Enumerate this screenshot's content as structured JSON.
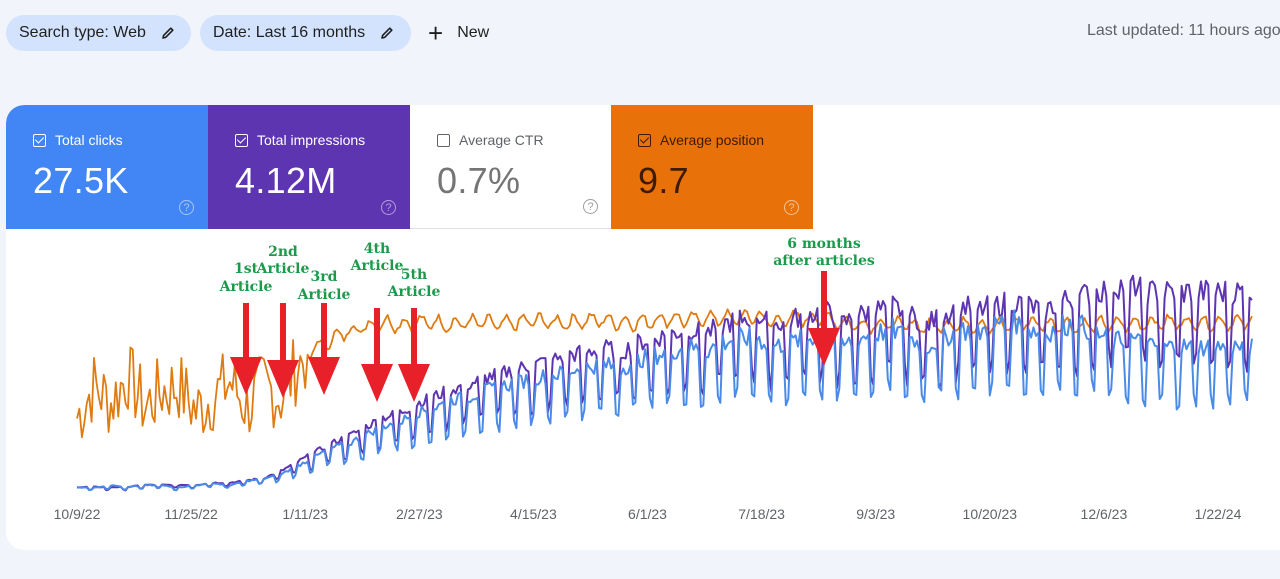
{
  "filters": {
    "chips": [
      {
        "label": "Search type: Web",
        "icon": "pencil-icon"
      },
      {
        "label": "Date: Last 16 months",
        "icon": "pencil-icon"
      }
    ],
    "new_label": "New",
    "new_icon": "plus-icon"
  },
  "last_updated": "Last updated: 11 hours ago",
  "metrics": [
    {
      "label": "Total clicks",
      "value": "27.5K",
      "checked": true,
      "color": "#4285f4"
    },
    {
      "label": "Total impressions",
      "value": "4.12M",
      "checked": true,
      "color": "#5e35b1"
    },
    {
      "label": "Average CTR",
      "value": "0.7%",
      "checked": false,
      "color": "#ffffff"
    },
    {
      "label": "Average position",
      "value": "9.7",
      "checked": true,
      "color": "#e8710a"
    }
  ],
  "help_glyph": "?",
  "chart_data": {
    "type": "line",
    "title": "",
    "xlabel": "",
    "ylabel": "",
    "x_ticks": [
      "10/9/22",
      "11/25/22",
      "1/11/23",
      "2/27/23",
      "4/15/23",
      "6/1/23",
      "7/18/23",
      "9/3/23",
      "10/20/23",
      "12/6/23",
      "1/22/24"
    ],
    "x_range": [
      "10/9/22",
      "2/5/24"
    ],
    "y_axis_labels_visible": false,
    "grid": false,
    "legend": "metric cards above chart",
    "series": [
      {
        "name": "Total clicks",
        "color": "#4a8be8",
        "description": "flat near zero until ~1/11/23, rises steadily with weekly oscillation to ~60-75% of scale by 9/3/23, then oscillates broadly 35-90% of scale",
        "weekly_values_relative": [
          0.02,
          0.02,
          0.03,
          0.02,
          0.03,
          0.03,
          0.02,
          0.03,
          0.04,
          0.03,
          0.05,
          0.06,
          0.08,
          0.12,
          0.16,
          0.2,
          0.22,
          0.26,
          0.3,
          0.32,
          0.36,
          0.38,
          0.42,
          0.43,
          0.46,
          0.48,
          0.5,
          0.52,
          0.53,
          0.55,
          0.57,
          0.58,
          0.56,
          0.6,
          0.62,
          0.64,
          0.66,
          0.64,
          0.68,
          0.7,
          0.7,
          0.66,
          0.68,
          0.7,
          0.72,
          0.66,
          0.7,
          0.72,
          0.74,
          0.7,
          0.66,
          0.7,
          0.74,
          0.72,
          0.76,
          0.78,
          0.74,
          0.72,
          0.76,
          0.76,
          0.72,
          0.68,
          0.7,
          0.66
        ]
      },
      {
        "name": "Total impressions",
        "color": "#5e35b1",
        "description": "tracks clicks closely, slightly higher peaks; ends near top of plot",
        "weekly_values_relative": [
          0.02,
          0.02,
          0.02,
          0.02,
          0.03,
          0.03,
          0.03,
          0.03,
          0.04,
          0.04,
          0.05,
          0.06,
          0.09,
          0.13,
          0.17,
          0.21,
          0.24,
          0.28,
          0.32,
          0.34,
          0.38,
          0.41,
          0.44,
          0.46,
          0.49,
          0.51,
          0.53,
          0.55,
          0.57,
          0.59,
          0.6,
          0.62,
          0.6,
          0.64,
          0.66,
          0.68,
          0.7,
          0.68,
          0.72,
          0.74,
          0.76,
          0.72,
          0.74,
          0.76,
          0.78,
          0.72,
          0.76,
          0.78,
          0.8,
          0.76,
          0.72,
          0.76,
          0.8,
          0.78,
          0.8,
          0.82,
          0.8,
          0.78,
          0.82,
          0.84,
          0.86,
          0.88,
          0.9,
          0.86
        ]
      },
      {
        "name": "Average position",
        "color": "#e07b12",
        "description": "noisy & lower early (before articles), jumps up ~1/11/23–2/27/23, then steady near upper-middle with small oscillation",
        "weekly_values_relative": [
          0.35,
          0.5,
          0.42,
          0.55,
          0.4,
          0.48,
          0.5,
          0.38,
          0.45,
          0.52,
          0.4,
          0.5,
          0.45,
          0.6,
          0.68,
          0.72,
          0.76,
          0.78,
          0.8,
          0.79,
          0.8,
          0.8,
          0.79,
          0.8,
          0.8,
          0.79,
          0.8,
          0.81,
          0.8,
          0.8,
          0.81,
          0.81,
          0.8,
          0.8,
          0.81,
          0.82,
          0.81,
          0.82,
          0.82,
          0.82,
          0.83,
          0.8,
          0.82,
          0.82,
          0.82,
          0.8,
          0.79,
          0.79,
          0.79,
          0.79,
          0.78,
          0.79,
          0.79,
          0.79,
          0.78,
          0.79,
          0.8,
          0.79,
          0.79,
          0.78,
          0.79,
          0.79,
          0.79,
          0.8
        ]
      }
    ],
    "annotations": [
      {
        "text": [
          "1st",
          "Article"
        ],
        "date": "12/9/22"
      },
      {
        "text": [
          "2nd",
          "Article"
        ],
        "date": "12/26/22"
      },
      {
        "text": [
          "3rd",
          "Article"
        ],
        "date": "1/11/23"
      },
      {
        "text": [
          "4th",
          "Article"
        ],
        "date": "1/31/23"
      },
      {
        "text": [
          "5th",
          "Article"
        ],
        "date": "2/13/23"
      },
      {
        "text": [
          "6 months",
          "after articles"
        ],
        "date": "8/18/23"
      }
    ],
    "annotation_color": "#1a9a4a",
    "arrow_color": "#e8202a"
  }
}
